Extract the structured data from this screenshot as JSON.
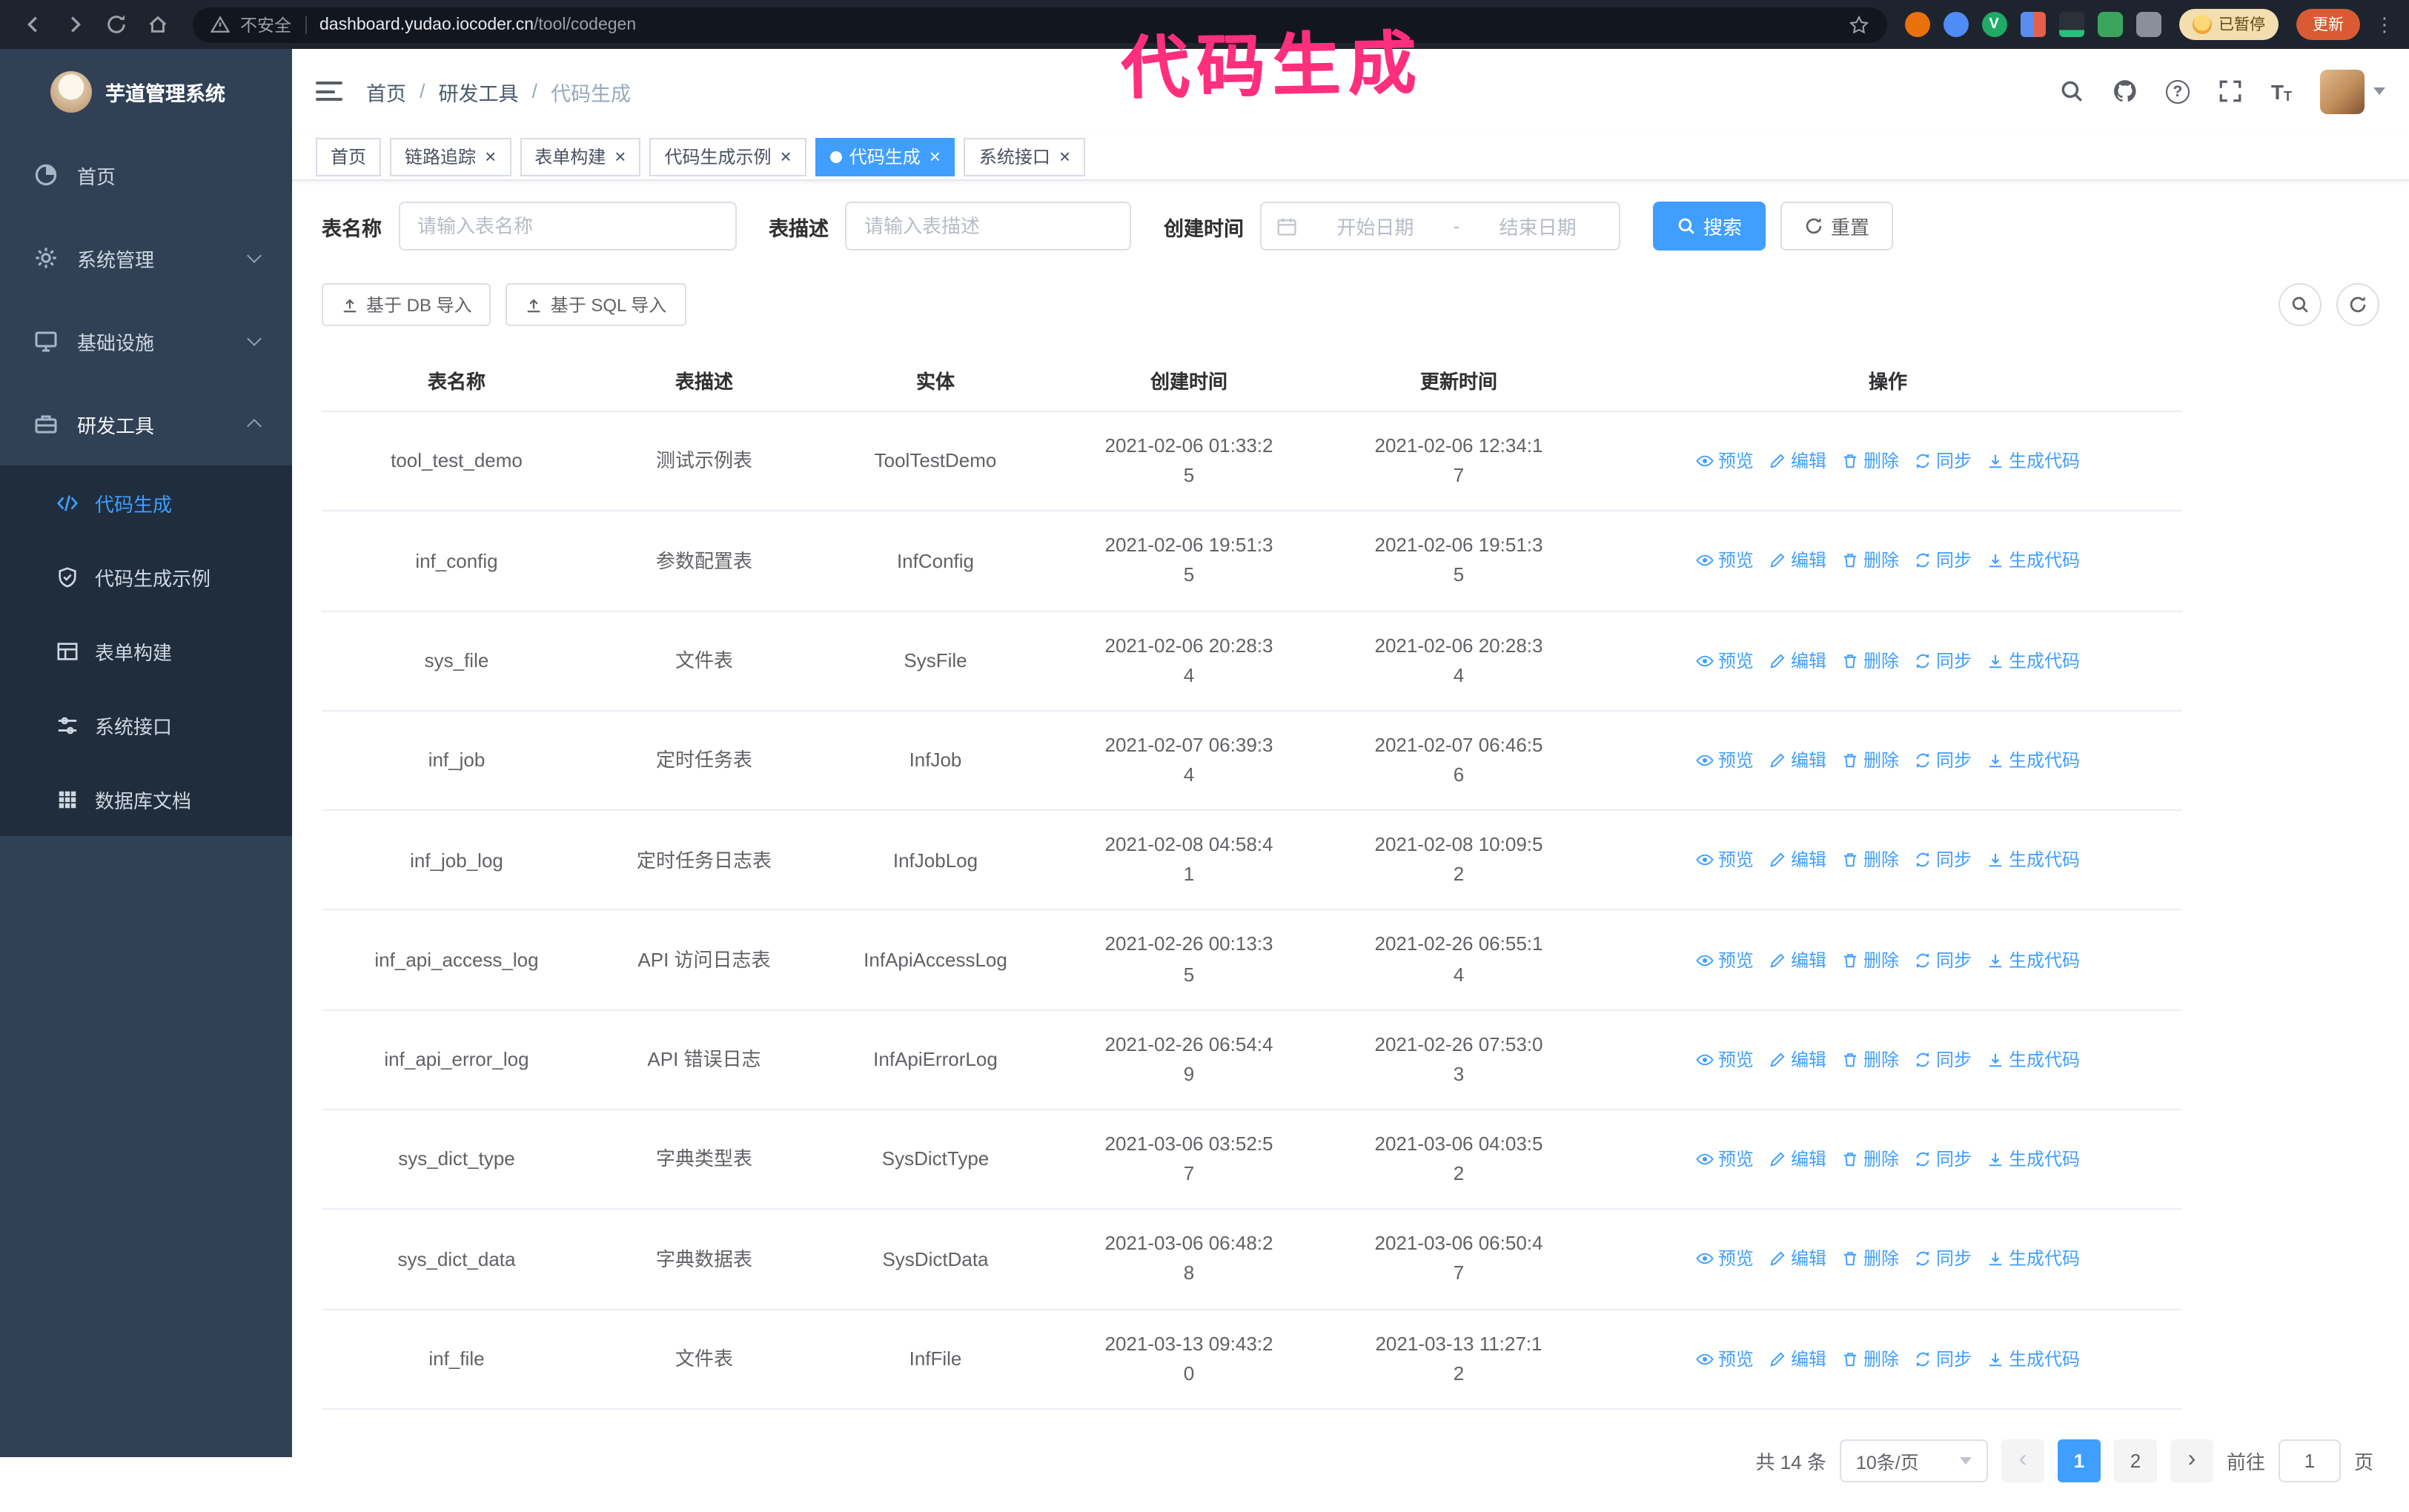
{
  "colors": {
    "accent": "#409eff",
    "annotation_pink": "#ff2f7e",
    "sidebar_bg": "#304156",
    "submenu_bg": "#1f2d3d"
  },
  "annotation": "代码生成",
  "browser": {
    "security_label": "不安全",
    "url_host": "dashboard.yudao.iocoder.cn",
    "url_path": "/tool/codegen",
    "paused_badge": "已暂停",
    "update_button": "更新"
  },
  "sidebar": {
    "logo_title": "芋道管理系统",
    "items": [
      {
        "id": "home",
        "label": "首页",
        "icon": "dashboard"
      },
      {
        "id": "system",
        "label": "系统管理",
        "icon": "gear",
        "chevron": "down"
      },
      {
        "id": "infra",
        "label": "基础设施",
        "icon": "infra",
        "chevron": "down"
      },
      {
        "id": "devtools",
        "label": "研发工具",
        "icon": "tools",
        "chevron": "up",
        "expanded": true,
        "children": [
          {
            "id": "codegen",
            "label": "代码生成",
            "icon": "code",
            "active": true
          },
          {
            "id": "codegen-example",
            "label": "代码生成示例",
            "icon": "example"
          },
          {
            "id": "form-builder",
            "label": "表单构建",
            "icon": "form"
          },
          {
            "id": "api",
            "label": "系统接口",
            "icon": "api"
          },
          {
            "id": "db-doc",
            "label": "数据库文档",
            "icon": "db"
          }
        ]
      }
    ]
  },
  "header": {
    "breadcrumb": [
      "首页",
      "研发工具",
      "代码生成"
    ]
  },
  "tabs": [
    {
      "id": "home",
      "label": "首页",
      "closable": false,
      "active": false
    },
    {
      "id": "tracing",
      "label": "链路追踪",
      "closable": true,
      "active": false
    },
    {
      "id": "form-builder",
      "label": "表单构建",
      "closable": true,
      "active": false
    },
    {
      "id": "codegen-example",
      "label": "代码生成示例",
      "closable": true,
      "active": false
    },
    {
      "id": "codegen",
      "label": "代码生成",
      "closable": true,
      "active": true
    },
    {
      "id": "api",
      "label": "系统接口",
      "closable": true,
      "active": false
    }
  ],
  "filters": {
    "table_name_label": "表名称",
    "table_name_placeholder": "请输入表名称",
    "table_desc_label": "表描述",
    "table_desc_placeholder": "请输入表描述",
    "create_time_label": "创建时间",
    "date_start_placeholder": "开始日期",
    "date_separator": "-",
    "date_end_placeholder": "结束日期",
    "search_button": "搜索",
    "reset_button": "重置"
  },
  "toolbar": {
    "import_db_button": "基于 DB 导入",
    "import_sql_button": "基于 SQL 导入"
  },
  "table": {
    "columns": [
      "表名称",
      "表描述",
      "实体",
      "创建时间",
      "更新时间",
      "操作"
    ],
    "actions": [
      {
        "id": "preview",
        "label": "预览",
        "icon": "eye"
      },
      {
        "id": "edit",
        "label": "编辑",
        "icon": "edit"
      },
      {
        "id": "delete",
        "label": "删除",
        "icon": "trash"
      },
      {
        "id": "sync",
        "label": "同步",
        "icon": "sync"
      },
      {
        "id": "generate",
        "label": "生成代码",
        "icon": "download"
      }
    ],
    "rows": [
      {
        "name": "tool_test_demo",
        "desc": "测试示例表",
        "entity": "ToolTestDemo",
        "created": "2021-02-06 01:33:25",
        "updated": "2021-02-06 12:34:17"
      },
      {
        "name": "inf_config",
        "desc": "参数配置表",
        "entity": "InfConfig",
        "created": "2021-02-06 19:51:35",
        "updated": "2021-02-06 19:51:35"
      },
      {
        "name": "sys_file",
        "desc": "文件表",
        "entity": "SysFile",
        "created": "2021-02-06 20:28:34",
        "updated": "2021-02-06 20:28:34"
      },
      {
        "name": "inf_job",
        "desc": "定时任务表",
        "entity": "InfJob",
        "created": "2021-02-07 06:39:34",
        "updated": "2021-02-07 06:46:56"
      },
      {
        "name": "inf_job_log",
        "desc": "定时任务日志表",
        "entity": "InfJobLog",
        "created": "2021-02-08 04:58:41",
        "updated": "2021-02-08 10:09:52"
      },
      {
        "name": "inf_api_access_log",
        "desc": "API 访问日志表",
        "entity": "InfApiAccessLog",
        "created": "2021-02-26 00:13:35",
        "updated": "2021-02-26 06:55:14"
      },
      {
        "name": "inf_api_error_log",
        "desc": "API 错误日志",
        "entity": "InfApiErrorLog",
        "created": "2021-02-26 06:54:49",
        "updated": "2021-02-26 07:53:03"
      },
      {
        "name": "sys_dict_type",
        "desc": "字典类型表",
        "entity": "SysDictType",
        "created": "2021-03-06 03:52:57",
        "updated": "2021-03-06 04:03:52"
      },
      {
        "name": "sys_dict_data",
        "desc": "字典数据表",
        "entity": "SysDictData",
        "created": "2021-03-06 06:48:28",
        "updated": "2021-03-06 06:50:47"
      },
      {
        "name": "inf_file",
        "desc": "文件表",
        "entity": "InfFile",
        "created": "2021-03-13 09:43:20",
        "updated": "2021-03-13 11:27:12"
      }
    ]
  },
  "pagination": {
    "total": "共 14 条",
    "page_size": "10条/页",
    "pages": [
      "1",
      "2"
    ],
    "active_page": "1",
    "goto_label": "前往",
    "goto_value": "1",
    "page_unit": "页"
  }
}
